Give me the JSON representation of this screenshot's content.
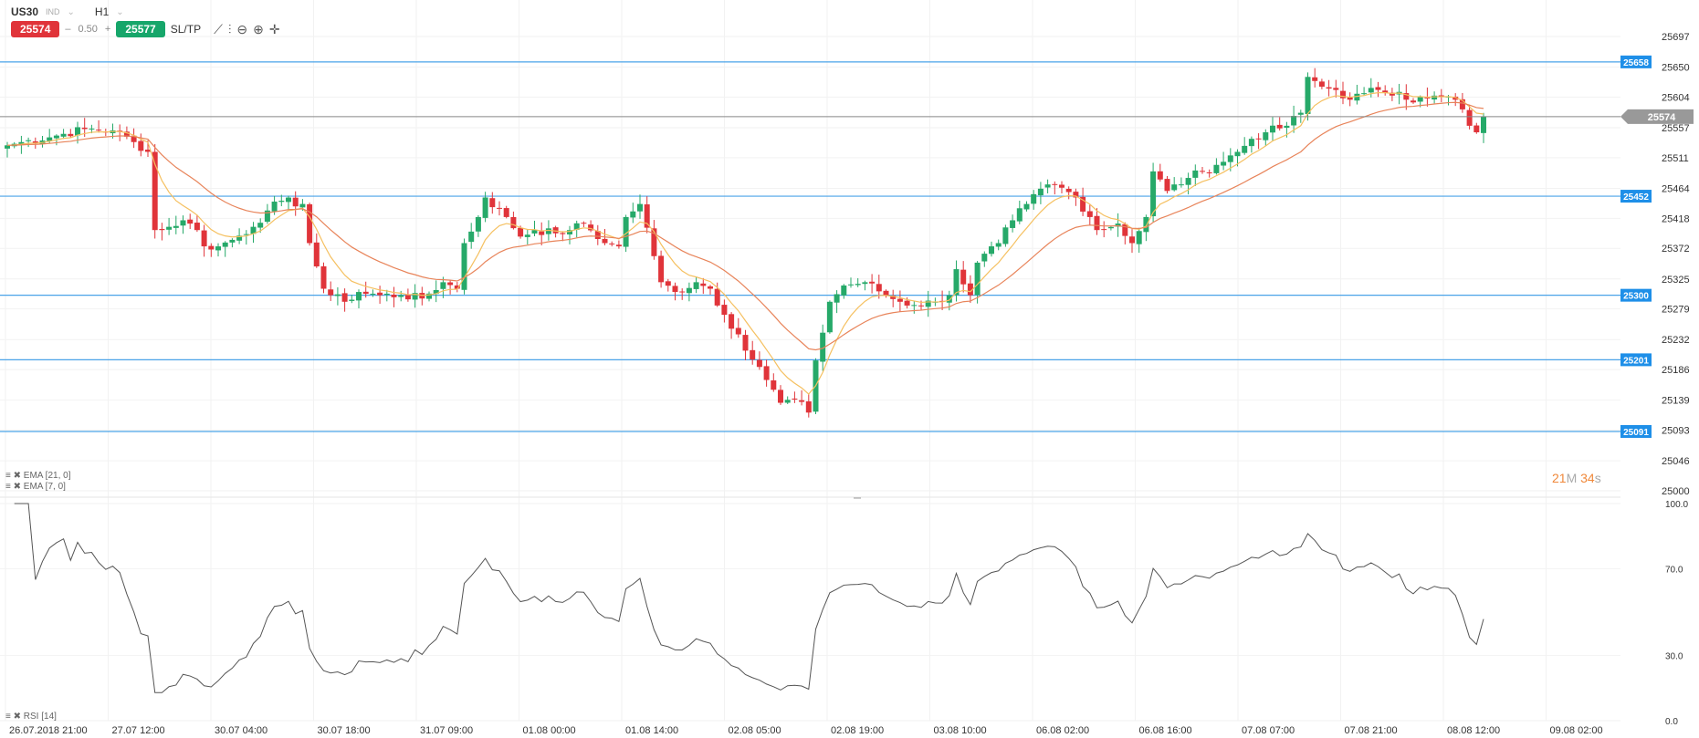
{
  "header": {
    "symbol": "US30",
    "symbol_type": "IND",
    "timeframe": "H1",
    "sell_price": "25574",
    "spread": "0.50",
    "minus": "–",
    "plus": "+",
    "buy_price": "25577",
    "sltp_label": "SL/TP"
  },
  "toolbar_icons": [
    "line-chart-icon",
    "candles-icon",
    "zoom-out-icon",
    "zoom-in-icon",
    "crosshair-icon"
  ],
  "legend": {
    "ema21": "EMA [21, 0]",
    "ema7": "EMA [7, 0]",
    "rsi": "RSI [14]"
  },
  "timer": {
    "minutes": "21",
    "m": "M",
    "seconds": "34",
    "s": "s"
  },
  "price_axis": [
    "25697",
    "25650",
    "25604",
    "25557",
    "25511",
    "25464",
    "25418",
    "25372",
    "25325",
    "25279",
    "25232",
    "25186",
    "25139",
    "25093",
    "25046",
    "25000"
  ],
  "rsi_axis": [
    "100.0",
    "70.0",
    "30.0",
    "0.0"
  ],
  "time_axis": [
    "26.07.2018 21:00",
    "27.07 12:00",
    "30.07 04:00",
    "30.07 18:00",
    "31.07 09:00",
    "01.08 00:00",
    "01.08 14:00",
    "02.08 05:00",
    "02.08 19:00",
    "03.08 10:00",
    "06.08 02:00",
    "06.08 16:00",
    "07.08 07:00",
    "07.08 21:00",
    "08.08 12:00",
    "09.08 02:00"
  ],
  "levels": [
    "25658",
    "25452",
    "25300",
    "25201",
    "25091"
  ],
  "current_price": "25574",
  "colors": {
    "up": "#26a969",
    "down": "#e0343a",
    "level": "#4aa3e8",
    "level_tag": "#1e8fe8",
    "ema7": "#f5c060",
    "ema21": "#e8845a",
    "rsi": "#555555",
    "current": "#888888"
  },
  "chart_data": {
    "type": "candlestick",
    "price_range": [
      25000,
      25697
    ],
    "rsi_range": [
      0,
      100
    ],
    "candle_count": 211,
    "close_keypoints": [
      [
        0,
        25530
      ],
      [
        2,
        25535
      ],
      [
        7,
        25545
      ],
      [
        11,
        25555
      ],
      [
        15,
        25553
      ],
      [
        18,
        25535
      ],
      [
        20,
        25520
      ],
      [
        21,
        25400
      ],
      [
        22,
        25400
      ],
      [
        25,
        25415
      ],
      [
        27,
        25400
      ],
      [
        28,
        25375
      ],
      [
        30,
        25375
      ],
      [
        32,
        25385
      ],
      [
        35,
        25405
      ],
      [
        37,
        25430
      ],
      [
        39,
        25445
      ],
      [
        42,
        25440
      ],
      [
        43,
        25380
      ],
      [
        45,
        25310
      ],
      [
        46,
        25300
      ],
      [
        48,
        25290
      ],
      [
        50,
        25305
      ],
      [
        53,
        25300
      ],
      [
        56,
        25300
      ],
      [
        59,
        25295
      ],
      [
        62,
        25320
      ],
      [
        64,
        25310
      ],
      [
        65,
        25380
      ],
      [
        67,
        25420
      ],
      [
        68,
        25450
      ],
      [
        71,
        25420
      ],
      [
        73,
        25390
      ],
      [
        75,
        25400
      ],
      [
        78,
        25395
      ],
      [
        80,
        25400
      ],
      [
        82,
        25410
      ],
      [
        85,
        25380
      ],
      [
        87,
        25375
      ],
      [
        88,
        25420
      ],
      [
        90,
        25440
      ],
      [
        92,
        25360
      ],
      [
        93,
        25320
      ],
      [
        95,
        25305
      ],
      [
        98,
        25320
      ],
      [
        100,
        25310
      ],
      [
        102,
        25270
      ],
      [
        104,
        25240
      ],
      [
        105,
        25215
      ],
      [
        107,
        25190
      ],
      [
        108,
        25170
      ],
      [
        110,
        25135
      ],
      [
        112,
        25140
      ],
      [
        114,
        25120
      ],
      [
        115,
        25200
      ],
      [
        117,
        25290
      ],
      [
        119,
        25315
      ],
      [
        122,
        25320
      ],
      [
        125,
        25300
      ],
      [
        127,
        25290
      ],
      [
        129,
        25285
      ],
      [
        132,
        25290
      ],
      [
        134,
        25300
      ],
      [
        135,
        25340
      ],
      [
        137,
        25300
      ],
      [
        138,
        25350
      ],
      [
        141,
        25380
      ],
      [
        143,
        25415
      ],
      [
        145,
        25440
      ],
      [
        148,
        25470
      ],
      [
        150,
        25465
      ],
      [
        152,
        25450
      ],
      [
        154,
        25420
      ],
      [
        155,
        25400
      ],
      [
        158,
        25410
      ],
      [
        160,
        25380
      ],
      [
        162,
        25420
      ],
      [
        163,
        25490
      ],
      [
        165,
        25460
      ],
      [
        168,
        25480
      ],
      [
        170,
        25490
      ],
      [
        172,
        25500
      ],
      [
        175,
        25520
      ],
      [
        177,
        25540
      ],
      [
        179,
        25550
      ],
      [
        182,
        25560
      ],
      [
        184,
        25580
      ],
      [
        185,
        25635
      ],
      [
        187,
        25620
      ],
      [
        189,
        25615
      ],
      [
        191,
        25600
      ],
      [
        193,
        25610
      ],
      [
        195,
        25615
      ],
      [
        198,
        25612
      ],
      [
        199,
        25600
      ],
      [
        202,
        25602
      ],
      [
        204,
        25605
      ],
      [
        206,
        25600
      ],
      [
        208,
        25560
      ],
      [
        209,
        25550
      ],
      [
        210,
        25574
      ]
    ]
  }
}
